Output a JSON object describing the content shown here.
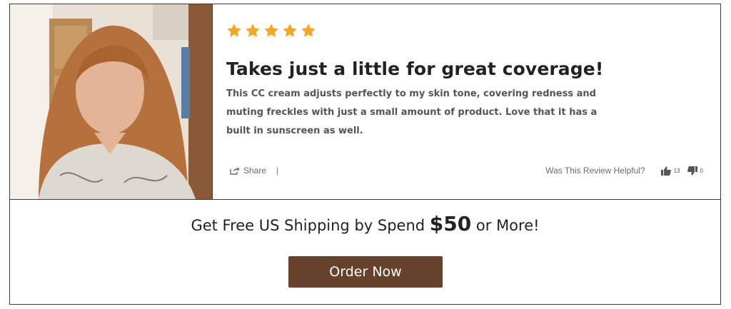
{
  "review": {
    "rating": 5,
    "max_rating": 5,
    "star_color": "#f5a623",
    "title": "Takes just a little for great coverage!",
    "body": "This CC cream adjusts perfectly to my skin tone, covering redness and muting freckles with just a small amount of product. Love that it has a built in sunscreen as well.",
    "share_label": "Share",
    "separator": "|",
    "helpful_question": "Was This Review Helpful?",
    "helpful_up_count": "13",
    "helpful_down_count": "0"
  },
  "promo": {
    "text_before": "Get Free US Shipping by Spend ",
    "amount": "$50",
    "text_after": " or More!",
    "order_button_label": "Order Now",
    "button_color": "#66412b"
  },
  "icons": [
    "star-icon",
    "share-icon",
    "thumbs-up-icon",
    "thumbs-down-icon"
  ]
}
